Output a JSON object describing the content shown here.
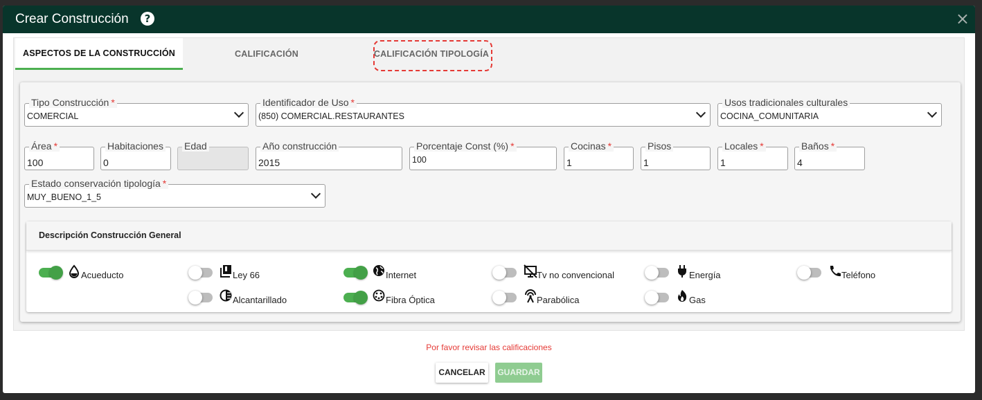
{
  "dialog": {
    "title": "Crear Construcción",
    "help_icon": "?",
    "close_icon": "×"
  },
  "tabs": [
    {
      "label": "ASPECTOS DE LA CONSTRUCCIÓN",
      "active": true
    },
    {
      "label": "CALIFICACIÓN",
      "active": false
    },
    {
      "label": "CALIFICACIÓN TIPOLOGÍA",
      "active": false,
      "highlighted": true
    }
  ],
  "form": {
    "tipo_construccion": {
      "label": "Tipo Construcción",
      "value": "COMERCIAL"
    },
    "identificador_uso": {
      "label": "Identificador de Uso",
      "value": "(850) COMERCIAL.RESTAURANTES"
    },
    "usos_tradicionales": {
      "label": "Usos tradicionales culturales",
      "value": "COCINA_COMUNITARIA"
    },
    "area": {
      "label": "Área",
      "value": "100"
    },
    "habitaciones": {
      "label": "Habitaciones",
      "value": "0"
    },
    "edad": {
      "label": "Edad",
      "value": ""
    },
    "anio_construccion": {
      "label": "Año construcción",
      "value": "2015"
    },
    "porcentaje_const": {
      "label": "Porcentaje Const (%)",
      "value": "100"
    },
    "cocinas": {
      "label": "Cocinas",
      "value": "1"
    },
    "pisos": {
      "label": "Pisos",
      "value": "1"
    },
    "locales": {
      "label": "Locales",
      "value": "1"
    },
    "banos": {
      "label": "Baños",
      "value": "4"
    },
    "estado_conservacion": {
      "label": "Estado conservación tipología",
      "value": "MUY_BUENO_1_5"
    },
    "required_mark": "*"
  },
  "descripcion": {
    "title": "Descripción Construcción General",
    "services": [
      {
        "label": "Acueducto",
        "icon": "water-drop-icon",
        "on": true
      },
      {
        "label": "Ley 66",
        "icon": "library-icon",
        "on": false
      },
      {
        "label": "Internet",
        "icon": "globe-icon",
        "on": true
      },
      {
        "label": "Tv no convencional",
        "icon": "tv-off-icon",
        "on": false
      },
      {
        "label": "Energía",
        "icon": "plug-icon",
        "on": false
      },
      {
        "label": "Teléfono",
        "icon": "phone-icon",
        "on": false
      },
      {
        "label": "Alcantarillado",
        "icon": "half-circle-icon",
        "on": false
      },
      {
        "label": "Fibra Óptica",
        "icon": "fiber-icon",
        "on": true
      },
      {
        "label": "Parabólica",
        "icon": "satellite-icon",
        "on": false
      },
      {
        "label": "Gas",
        "icon": "flame-icon",
        "on": false
      }
    ]
  },
  "footer": {
    "error": "Por favor revisar las calificaciones",
    "cancel": "CANCELAR",
    "save": "GUARDAR"
  },
  "colors": {
    "titlebar": "#08352b",
    "accent": "#4caf50",
    "error": "#e53935",
    "highlight": "#e53935"
  }
}
